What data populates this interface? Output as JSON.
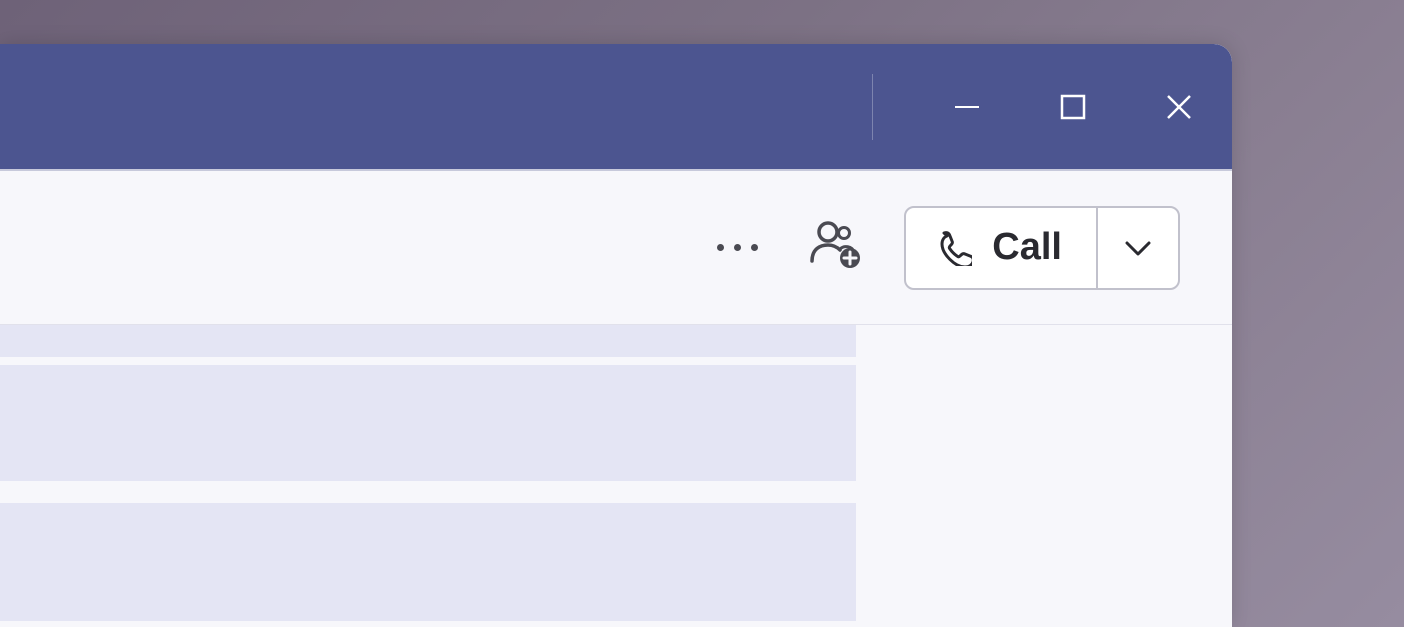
{
  "header": {
    "call_label": "Call"
  },
  "icons": {
    "minimize": "minimize-icon",
    "maximize": "maximize-icon",
    "close": "close-icon",
    "more": "more-icon",
    "add_people": "add-people-icon",
    "phone": "phone-icon",
    "chevron_down": "chevron-down-icon"
  },
  "colors": {
    "titlebar": "#4c5590",
    "surface": "#f7f7fb",
    "message_bg": "#e4e5f4",
    "border": "#c1c1cc"
  }
}
